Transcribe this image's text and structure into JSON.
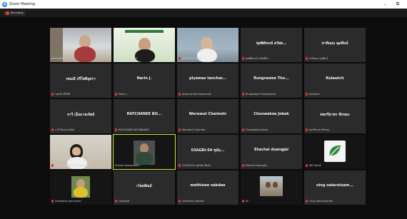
{
  "window": {
    "title": "Zoom Meeting",
    "minimize": "–",
    "maximize": "⧉"
  },
  "recording": {
    "label": "Recording"
  },
  "tiles": [
    {
      "name": "",
      "label": "pinnedPM",
      "video": true
    },
    {
      "name": "",
      "label": "BHUTAN PRESENT",
      "video": true
    },
    {
      "name": "",
      "label": "ASR MSS-SETUP",
      "video": true
    },
    {
      "name": "ชุลพิตัทรณ์ สวัสส...",
      "label": "ชุลพิตัทรณ์ สวัสสดิ์มา",
      "video": false
    },
    {
      "name": "หาทิณณ ฉุดคีมน์",
      "label": "หาทิณณ ฉุดคีมน์",
      "video": false
    },
    {
      "name": "รสมณี ปรีใสดีอุตรา",
      "label": "รสมณี ปรีใสดี",
      "video": false
    },
    {
      "name": "Narin J.",
      "label": "Narin J.",
      "video": false
    },
    {
      "name": "piyamas tanchar...",
      "label": "piyamas tancharoenrat",
      "video": false
    },
    {
      "name": "Rungrawee Tho...",
      "label": "Rungrawee Thongnoisai",
      "video": false
    },
    {
      "name": "Kulawich",
      "label": "Kulawich",
      "video": false
    },
    {
      "name": "จาวี เอ็มมาลเจ้ดย์",
      "label": "จาวี เอ็มมาลเจ้ดย์",
      "video": false
    },
    {
      "name": "RATCHANEE BO...",
      "label": "RATCHANEE BOUNDAWS",
      "video": false
    },
    {
      "name": "Werawut Chaimetr",
      "label": "Werawut Chaimetr",
      "video": false
    },
    {
      "name": "Choowakoe Jobak",
      "label": "Choowakoe Jobak",
      "video": false
    },
    {
      "name": "ศตกรียาพร ฟักทอง",
      "label": "ศตกรียาพร ฟักทอง",
      "video": false
    },
    {
      "name": "",
      "label": "จิตรา มีสุขดี-(ครู Thai Dorothy)",
      "video": true
    },
    {
      "name": "",
      "label": "Suthee Kaewmeasri",
      "video": true
    },
    {
      "name": "03AGRI-04 ชุมัย...",
      "label": "03AGRI-04 ชุมัยพร ทิมคำ",
      "video": false
    },
    {
      "name": "Ekachai duangjai",
      "label": "Ekachai duangjai",
      "video": false
    },
    {
      "name": "",
      "label": "Wit Vendi",
      "video": true
    },
    {
      "name": "",
      "label": "Sathaphol pannibutri",
      "video": true
    },
    {
      "name": "เว้อยพัณม์",
      "label": "เว้อยพัณม์",
      "video": false
    },
    {
      "name": "methinee nakdee",
      "label": "methinee nakdee",
      "video": false
    },
    {
      "name": "",
      "label": "kk",
      "video": true
    },
    {
      "name": "ning satarutsam...",
      "label": "ning satarutsamee",
      "video": false
    }
  ]
}
